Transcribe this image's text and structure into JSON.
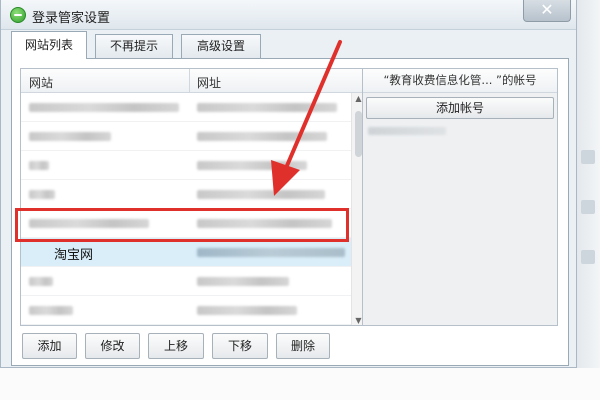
{
  "window": {
    "title": "登录管家设置",
    "close_glyph": "✕"
  },
  "tabs": [
    {
      "label": "网站列表",
      "active": true
    },
    {
      "label": "不再提示",
      "active": false
    },
    {
      "label": "高级设置",
      "active": false
    }
  ],
  "site_list": {
    "columns": {
      "site": "网站",
      "url": "网址"
    },
    "selected_site": "淘宝网"
  },
  "account_panel": {
    "header": "“教育收费信息化管...  ”的帐号",
    "add_button": "添加帐号"
  },
  "buttons": {
    "add": "添加",
    "edit": "修改",
    "move_up": "上移",
    "move_down": "下移",
    "delete": "删除"
  },
  "colors": {
    "annotation": "#e0302c",
    "selected_row": "#d9eef9",
    "title_icon": "#2f9e2c"
  },
  "icons": {
    "title": "green-circle-icon",
    "scroll_up": "triangle-up",
    "scroll_down": "triangle-down"
  }
}
